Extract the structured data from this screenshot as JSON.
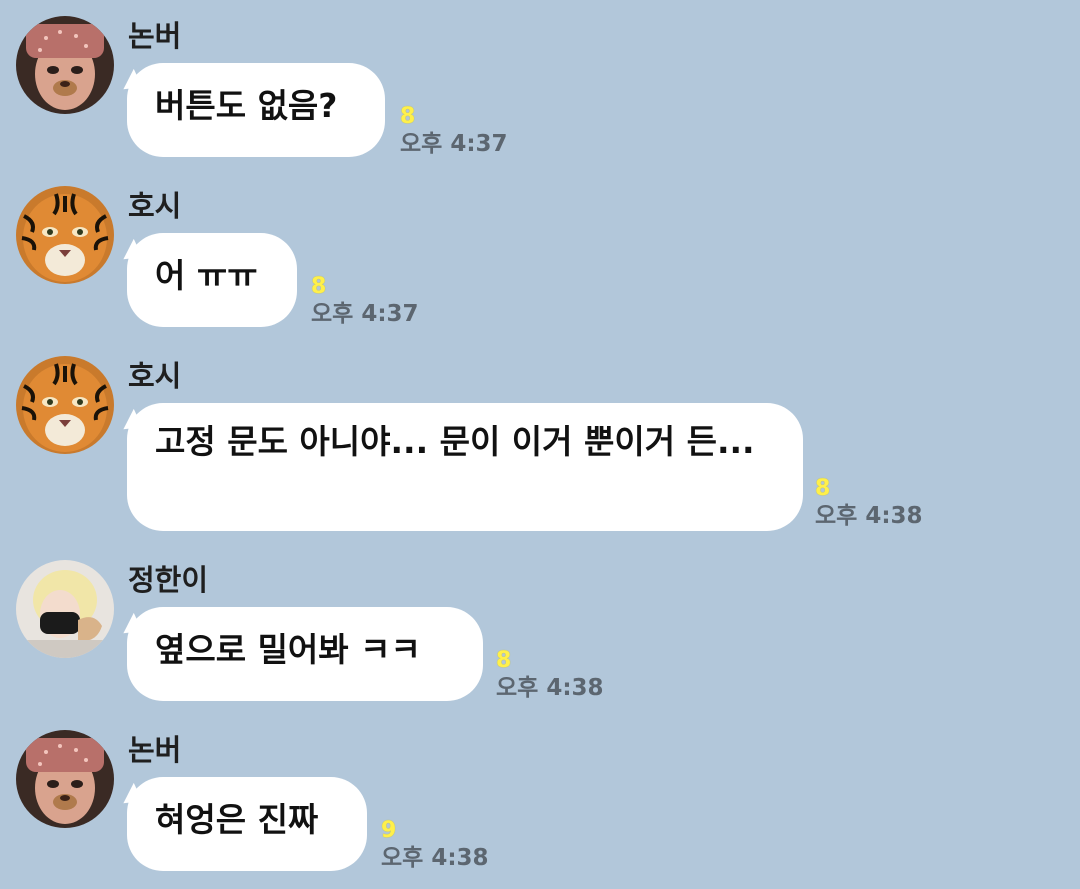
{
  "messages": [
    {
      "sender": "논버",
      "avatar_icon": "face-filter-avatar-icon",
      "text": "버튼도 없음?",
      "unread": "8",
      "time": "오후 4:37"
    },
    {
      "sender": "호시",
      "avatar_icon": "tiger-avatar-icon",
      "text": "어 ㅠㅠ",
      "unread": "8",
      "time": "오후 4:37"
    },
    {
      "sender": "호시",
      "avatar_icon": "tiger-avatar-icon",
      "text": "고정 문도 아니야... 문이 이거 뿐이거 든...",
      "unread": "8",
      "time": "오후 4:38"
    },
    {
      "sender": "정한이",
      "avatar_icon": "masked-person-avatar-icon",
      "text": "옆으로 밀어봐 ㅋㅋ",
      "unread": "8",
      "time": "오후 4:38"
    },
    {
      "sender": "논버",
      "avatar_icon": "face-filter-avatar-icon",
      "text": "혀엉은 진짜",
      "unread": "9",
      "time": "오후 4:38"
    }
  ],
  "colors": {
    "background": "#b2c7da",
    "bubble": "#ffffff",
    "unread": "#fff04a",
    "time": "#5c6670"
  }
}
